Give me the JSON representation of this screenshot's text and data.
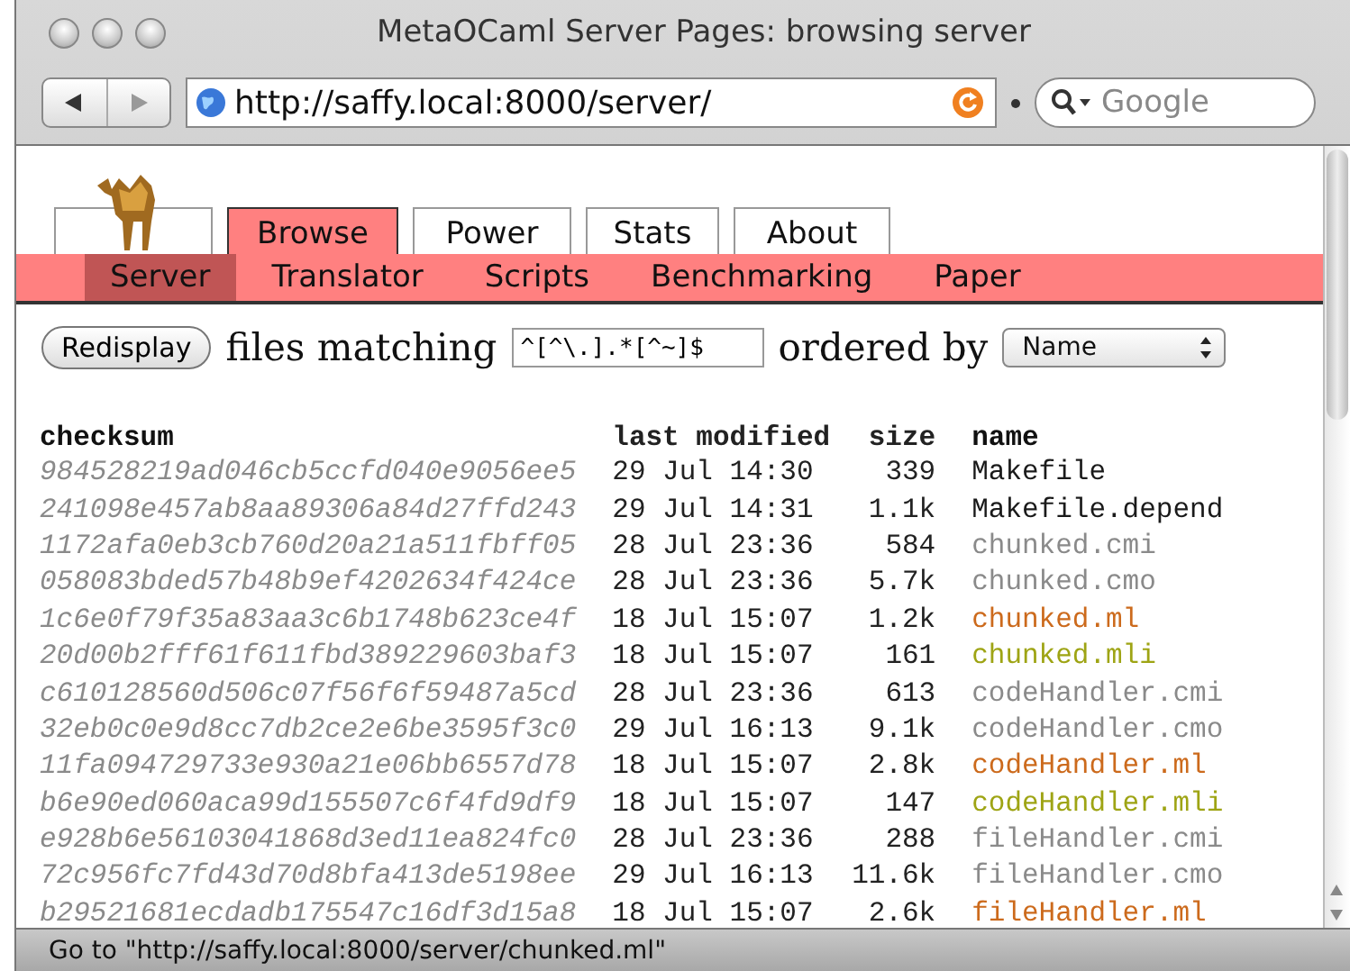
{
  "window": {
    "title": "MetaOCaml Server Pages: browsing server"
  },
  "address_bar": {
    "url": "http://saffy.local:8000/server/"
  },
  "search": {
    "placeholder": "Google"
  },
  "tabs": [
    {
      "label": "Browse",
      "selected": true
    },
    {
      "label": "Power",
      "selected": false
    },
    {
      "label": "Stats",
      "selected": false
    },
    {
      "label": "About",
      "selected": false
    }
  ],
  "subtabs": [
    {
      "label": "Server",
      "selected": true
    },
    {
      "label": "Translator",
      "selected": false
    },
    {
      "label": "Scripts",
      "selected": false
    },
    {
      "label": "Benchmarking",
      "selected": false
    },
    {
      "label": "Paper",
      "selected": false
    }
  ],
  "form": {
    "button": "Redisplay",
    "label_1": "files matching",
    "pattern": "^[^\\.].*[^~]$",
    "label_2": "ordered by",
    "order": "Name"
  },
  "table": {
    "columns": [
      "checksum",
      "last modified",
      "size",
      "name"
    ],
    "rows": [
      {
        "checksum": "984528219ad046cb5ccfd040e9056ee5",
        "modified": "29 Jul 14:30",
        "size": "339",
        "name": "Makefile",
        "color": "#1a1a1a"
      },
      {
        "checksum": "241098e457ab8aa89306a84d27ffd243",
        "modified": "29 Jul 14:31",
        "size": "1.1k",
        "name": "Makefile.depend",
        "color": "#1a1a1a"
      },
      {
        "checksum": "1172afa0eb3cb760d20a21a511fbff05",
        "modified": "28 Jul 23:36",
        "size": "584",
        "name": "chunked.cmi",
        "color": "#8a8a8a"
      },
      {
        "checksum": "058083bded57b48b9ef4202634f424ce",
        "modified": "28 Jul 23:36",
        "size": "5.7k",
        "name": "chunked.cmo",
        "color": "#8a8a8a"
      },
      {
        "checksum": "1c6e0f79f35a83aa3c6b1748b623ce4f",
        "modified": "18 Jul 15:07",
        "size": "1.2k",
        "name": "chunked.ml",
        "color": "#cc6a1c"
      },
      {
        "checksum": "20d00b2fff61f611fbd389229603baf3",
        "modified": "18 Jul 15:07",
        "size": "161",
        "name": "chunked.mli",
        "color": "#9ea414"
      },
      {
        "checksum": "c610128560d506c07f56f6f59487a5cd",
        "modified": "28 Jul 23:36",
        "size": "613",
        "name": "codeHandler.cmi",
        "color": "#8a8a8a"
      },
      {
        "checksum": "32eb0c0e9d8cc7db2ce2e6be3595f3c0",
        "modified": "29 Jul 16:13",
        "size": "9.1k",
        "name": "codeHandler.cmo",
        "color": "#8a8a8a"
      },
      {
        "checksum": "11fa094729733e930a21e06bb6557d78",
        "modified": "18 Jul 15:07",
        "size": "2.8k",
        "name": "codeHandler.ml",
        "color": "#cc6a1c"
      },
      {
        "checksum": "b6e90ed060aca99d155507c6f4fd9df9",
        "modified": "18 Jul 15:07",
        "size": "147",
        "name": "codeHandler.mli",
        "color": "#9ea414"
      },
      {
        "checksum": "e928b6e56103041868d3ed11ea824fc0",
        "modified": "28 Jul 23:36",
        "size": "288",
        "name": "fileHandler.cmi",
        "color": "#8a8a8a"
      },
      {
        "checksum": "72c956fc7fd43d70d8bfa413de5198ee",
        "modified": "29 Jul 16:13",
        "size": "11.6k",
        "name": "fileHandler.cmo",
        "color": "#8a8a8a"
      },
      {
        "checksum": "b29521681ecdadb175547c16df3d15a8",
        "modified": "18 Jul 15:07",
        "size": "2.6k",
        "name": "fileHandler.ml",
        "color": "#cc6a1c"
      }
    ]
  },
  "status_bar": "Go to \"http://saffy.local:8000/server/chunked.ml\""
}
